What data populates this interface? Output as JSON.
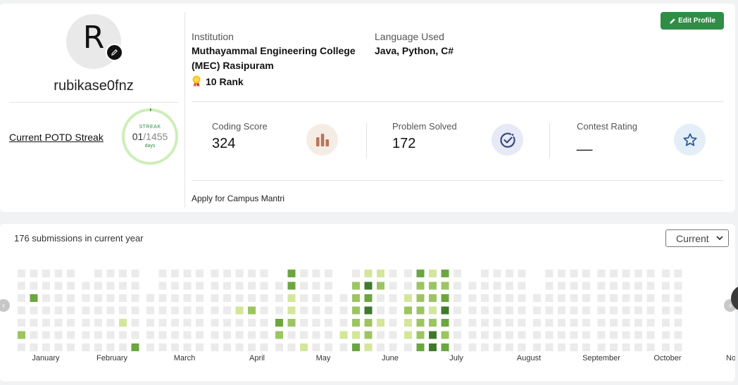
{
  "profile": {
    "avatar_letter": "R",
    "username": "rubikase0fnz",
    "edit_button_label": "Edit Profile",
    "institution_label": "Institution",
    "institution_line1": "Muthayammal Engineering College",
    "institution_line2": "(MEC) Rasipuram",
    "language_label": "Language Used",
    "languages": "Java, Python, C#",
    "rank": "10 Rank",
    "potd_link": "Current POTD Streak",
    "streak": {
      "label": "STREAK",
      "current": "01",
      "separator": "/",
      "total": "1455",
      "unit": "days",
      "progress": 0.0007
    },
    "stats": [
      {
        "label": "Coding Score",
        "value": "324",
        "icon": "bar-chart-icon"
      },
      {
        "label": "Problem Solved",
        "value": "172",
        "icon": "check-circle-icon"
      },
      {
        "label": "Contest Rating",
        "value": "__",
        "icon": "star-icon"
      }
    ],
    "campus_link": "Apply for Campus Mantri"
  },
  "heatmap": {
    "submissions_text": "176 submissions in current year",
    "year_select": "Current",
    "months": [
      "January",
      "February",
      "March",
      "April",
      "May",
      "June",
      "July",
      "August",
      "September",
      "October",
      "No"
    ],
    "colors": {
      "empty": "#ebebeb",
      "l1": "#d4e69b",
      "l2": "#9cc562",
      "l3": "#6ba640",
      "l4": "#3f7a2c",
      "accent": "#2f8d46"
    }
  }
}
